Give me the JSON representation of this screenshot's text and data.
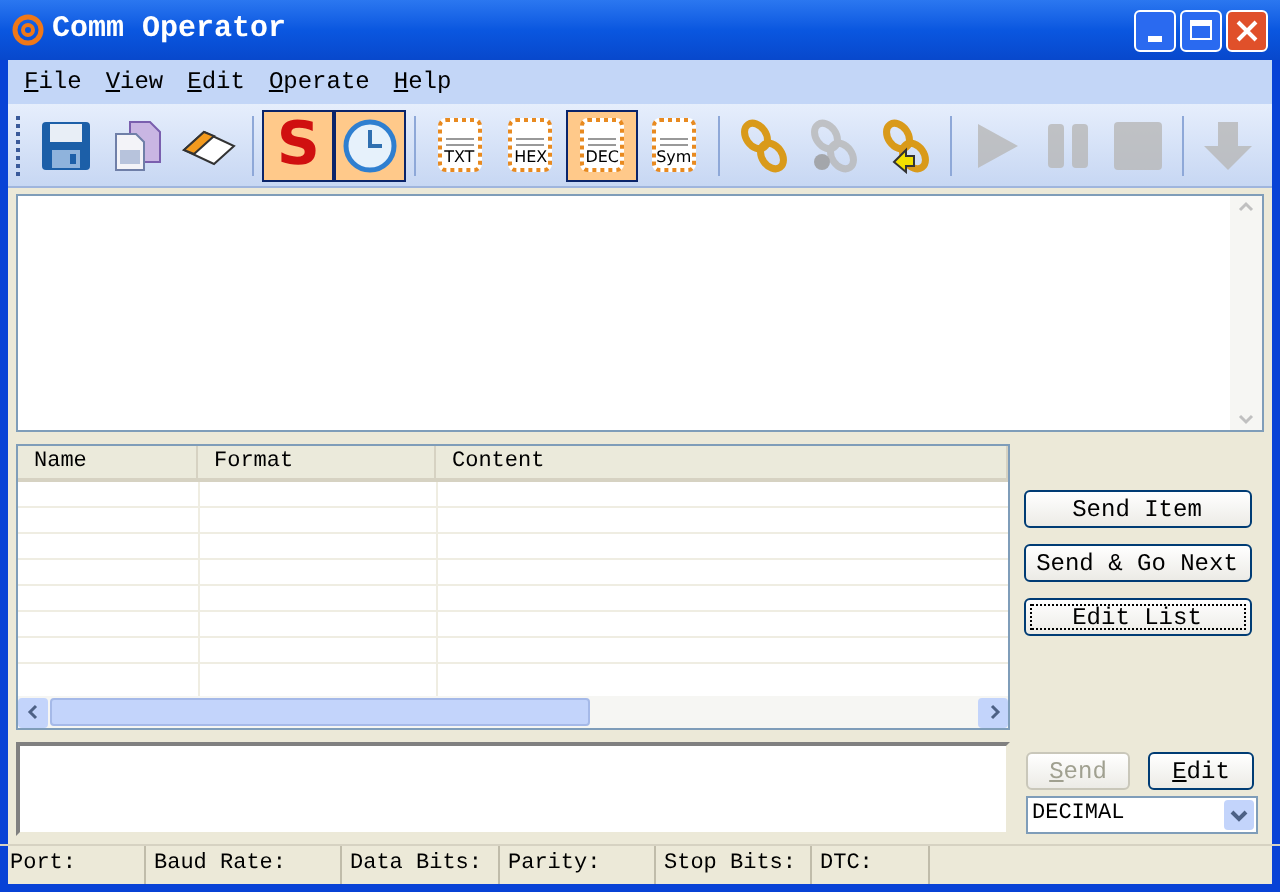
{
  "window": {
    "title": "Comm Operator"
  },
  "menu": [
    {
      "label": "File"
    },
    {
      "label": "View"
    },
    {
      "label": "Edit"
    },
    {
      "label": "Operate"
    },
    {
      "label": "Help"
    }
  ],
  "toolbar": [
    {
      "kind": "save"
    },
    {
      "kind": "copy"
    },
    {
      "kind": "eraser"
    },
    {
      "kind": "separator"
    },
    {
      "kind": "letter",
      "label": "S",
      "pressed": true
    },
    {
      "kind": "clock",
      "pressed": true
    },
    {
      "kind": "separator"
    },
    {
      "kind": "doc",
      "label": "TXT",
      "pressed": false
    },
    {
      "kind": "doc",
      "label": "HEX",
      "pressed": false
    },
    {
      "kind": "doc",
      "label": "DEC",
      "pressed": true
    },
    {
      "kind": "doc",
      "label": "Sym",
      "pressed": false
    },
    {
      "kind": "separator"
    },
    {
      "kind": "link",
      "disabled": false
    },
    {
      "kind": "unlink",
      "disabled": true
    },
    {
      "kind": "link-arrow",
      "disabled": false
    },
    {
      "kind": "separator"
    },
    {
      "kind": "play",
      "disabled": true
    },
    {
      "kind": "pause",
      "disabled": true
    },
    {
      "kind": "stop",
      "disabled": true
    },
    {
      "kind": "separator"
    },
    {
      "kind": "down",
      "disabled": true
    }
  ],
  "table": {
    "columns": [
      "Name",
      "Format",
      "Content"
    ]
  },
  "list_buttons": [
    {
      "label": "Send Item",
      "focused": false
    },
    {
      "label": "Send & Go Next",
      "focused": false
    },
    {
      "label": "Edit List",
      "focused": true
    }
  ],
  "send_button": {
    "label": "Send",
    "disabled": true
  },
  "edit_button": {
    "label": "Edit",
    "disabled": false
  },
  "format_select": {
    "value": "DECIMAL"
  },
  "status_bar": [
    "Port:",
    "Baud Rate:",
    "Data Bits:",
    "Parity:",
    "Stop Bits:",
    "DTC:"
  ]
}
